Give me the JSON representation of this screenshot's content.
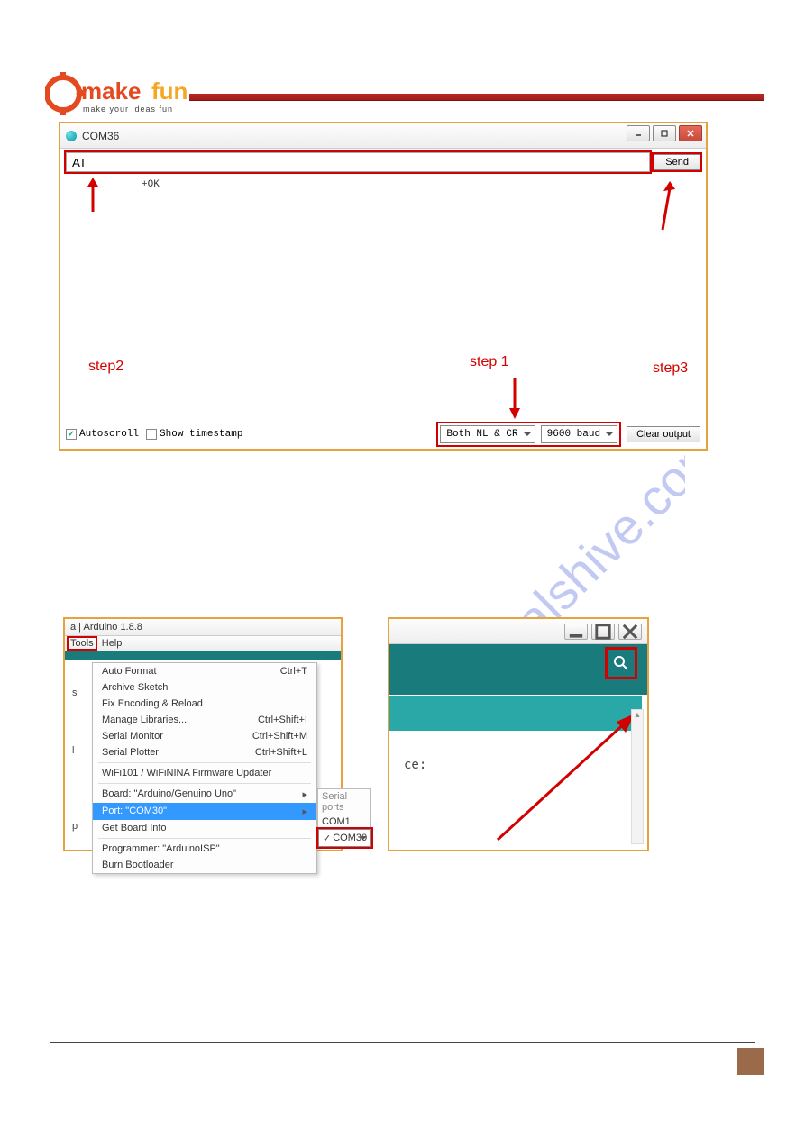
{
  "logo": {
    "brand": "makefun",
    "brand_prefix": "e",
    "tagline": "make your ideas fun"
  },
  "serial_monitor": {
    "title": "COM36",
    "input_value": "AT",
    "send_label": "Send",
    "output_line": "+OK",
    "autoscroll_label": "Autoscroll",
    "show_timestamp_label": "Show timestamp",
    "line_ending": "Both NL & CR",
    "baud": "9600 baud",
    "clear_label": "Clear output"
  },
  "callouts": {
    "step1": "step 1",
    "step2": "step2",
    "step3": "step3"
  },
  "watermark_host": "manualshive.com",
  "arduino_menu": {
    "app_title": "a | Arduino 1.8.8",
    "menus": {
      "tools": "Tools",
      "help": "Help"
    },
    "items": {
      "auto_format": "Auto Format",
      "auto_format_sc": "Ctrl+T",
      "archive": "Archive Sketch",
      "fix_encoding": "Fix Encoding & Reload",
      "manage_libs": "Manage Libraries...",
      "manage_libs_sc": "Ctrl+Shift+I",
      "serial_monitor": "Serial Monitor",
      "serial_monitor_sc": "Ctrl+Shift+M",
      "serial_plotter": "Serial Plotter",
      "serial_plotter_sc": "Ctrl+Shift+L",
      "wifi": "WiFi101 / WiFiNINA Firmware Updater",
      "board": "Board: \"Arduino/Genuino Uno\"",
      "port": "Port: \"COM30\"",
      "get_board": "Get Board Info",
      "programmer": "Programmer: \"ArduinoISP\"",
      "burn": "Burn Bootloader"
    },
    "port_submenu": {
      "header": "Serial ports",
      "com1": "COM1",
      "com30": "COM30",
      "check": "✓"
    },
    "gutter": {
      "s": "s",
      "l": "l",
      "p": "p"
    }
  },
  "shot2": {
    "body_text": "ce:"
  }
}
